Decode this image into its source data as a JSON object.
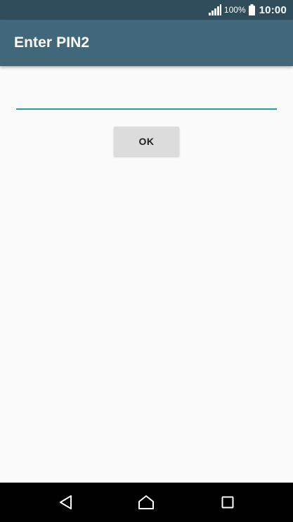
{
  "status_bar": {
    "battery_percent": "100%",
    "time": "10:00",
    "icons": [
      "signal-icon",
      "battery-icon"
    ]
  },
  "app_bar": {
    "title": "Enter PIN2"
  },
  "pin_entry": {
    "value": "",
    "placeholder": ""
  },
  "ok_button": {
    "label": "OK"
  },
  "nav_bar": {
    "icons": [
      "back-icon",
      "home-icon",
      "recents-icon"
    ]
  },
  "colors": {
    "status_bar": "#2f4c5a",
    "app_bar": "#41687a",
    "accent": "#1ea493",
    "background": "#fafafa",
    "button": "#dcdcdc",
    "nav_bar": "#000000"
  }
}
